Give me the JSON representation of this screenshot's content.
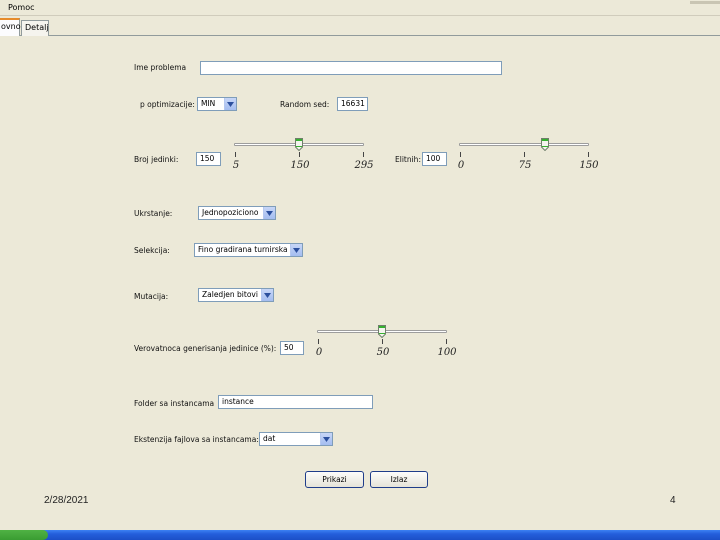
{
  "menu": {
    "items": [
      "Pomoc"
    ]
  },
  "tabs": [
    {
      "label": "ovno",
      "active": true
    },
    {
      "label": "Detalj",
      "active": false
    }
  ],
  "form": {
    "problem_name": {
      "label": "Ime problema",
      "value": ""
    },
    "optimization": {
      "label": "p optimizacije:",
      "value": "MIN"
    },
    "random_seed": {
      "label": "Random sed:",
      "value": "16631"
    },
    "unit_count": {
      "label": "Broj jedinki:",
      "value": "150",
      "slider": {
        "min": 5,
        "max": 295,
        "value": 150,
        "tick_labels": [
          "5",
          "150",
          "295"
        ]
      }
    },
    "elitism": {
      "label": "Elitnih:",
      "value": "100",
      "slider": {
        "min": 0,
        "max": 150,
        "value": 100,
        "tick_labels": [
          "0",
          "75",
          "150"
        ]
      }
    },
    "termination": {
      "label": "Ukrstanje:",
      "value": "Jednopoziciono"
    },
    "selection": {
      "label": "Selekcija:",
      "value": "Fino gradirana turnirska"
    },
    "mutation": {
      "label": "Mutacija:",
      "value": "Zaledjen bitovi"
    },
    "generation_probability": {
      "label": "Verovatnoca generisanja jedinice (%):",
      "value": "50",
      "slider": {
        "min": 0,
        "max": 100,
        "value": 50,
        "tick_labels": [
          "0",
          "50",
          "100"
        ]
      }
    },
    "instance_folder": {
      "label": "Folder sa instancama",
      "value": "instance"
    },
    "file_extension": {
      "label": "Ekstenzija fajlova sa instancama:",
      "value": "dat"
    }
  },
  "buttons": {
    "show": "Prikazi",
    "exit": "Izlaz"
  },
  "footer": {
    "date": "2/28/2021",
    "page": "4"
  },
  "colors": {
    "window_bg": "#ece9d8",
    "input_border": "#7f9db9",
    "tab_accent": "#e68b2c",
    "taskbar": "#245edb"
  }
}
